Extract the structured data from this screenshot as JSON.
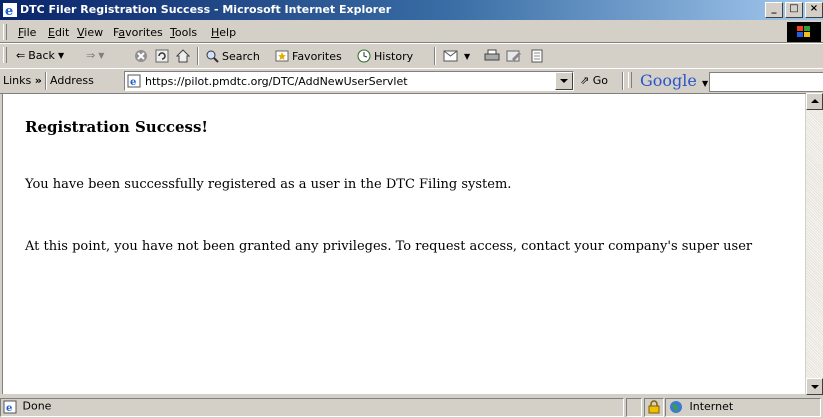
{
  "window": {
    "title": "DTC Filer Registration Success - Microsoft Internet Explorer",
    "controls": {
      "minimize": "_",
      "maximize": "□",
      "close": "×"
    }
  },
  "menu": [
    "File",
    "Edit",
    "View",
    "Favorites",
    "Tools",
    "Help"
  ],
  "menu_underline": [
    "F",
    "E",
    "V",
    "a",
    "T",
    "H"
  ],
  "toolbar": {
    "back": "Back",
    "search": "Search",
    "favorites": "Favorites",
    "history": "History"
  },
  "address_bar": {
    "links_label": "Links",
    "links_chevron": "»",
    "address_label": "Address",
    "url": "https://pilot.pmdtc.org/DTC/AddNewUserServlet",
    "go_label": "Go",
    "google_label": "Google"
  },
  "content": {
    "heading": "Registration Success!",
    "line1": "You have been successfully registered as a user in the DTC Filing system.",
    "line2": "At this point, you have not been granted any privileges.  To request access, contact your company's super user"
  },
  "status": {
    "text": "Done",
    "zone": "Internet"
  },
  "colors": {
    "titlebar_start": "#0a246a",
    "titlebar_end": "#a6caf0",
    "chrome": "#d4d0c8",
    "google_blue": "#2a55c8"
  }
}
